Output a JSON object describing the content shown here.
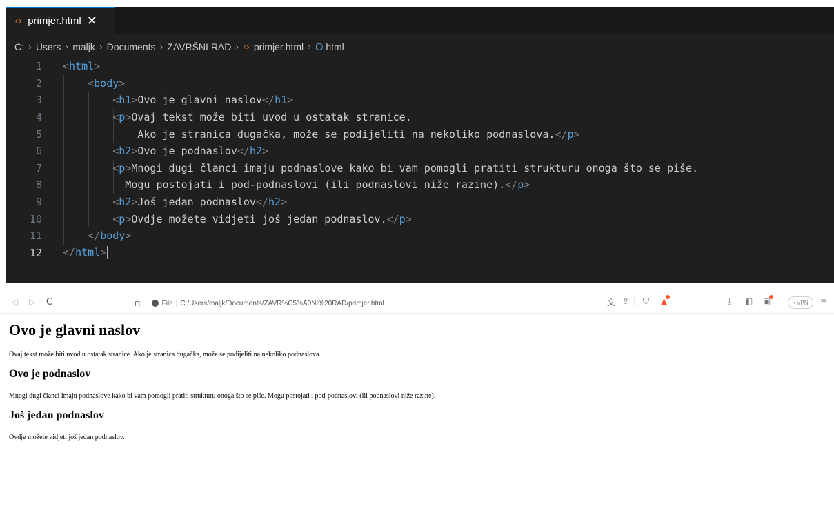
{
  "editor": {
    "tab": {
      "label": "primjer.html",
      "close": "✕"
    },
    "breadcrumb": {
      "items": [
        "C:",
        "Users",
        "maljk",
        "Documents",
        "ZAVRŠNI RAD",
        "primjer.html",
        "html"
      ]
    },
    "lines": [
      {
        "n": "1",
        "tokens": [
          [
            "br",
            "<"
          ],
          [
            "tag",
            "html"
          ],
          [
            "br",
            ">"
          ]
        ]
      },
      {
        "n": "2",
        "tokens": [
          [
            "txt",
            "    "
          ],
          [
            "br",
            "<"
          ],
          [
            "tag",
            "body"
          ],
          [
            "br",
            ">"
          ]
        ]
      },
      {
        "n": "3",
        "tokens": [
          [
            "txt",
            "        "
          ],
          [
            "br",
            "<"
          ],
          [
            "tag",
            "h1"
          ],
          [
            "br",
            ">"
          ],
          [
            "txt",
            "Ovo je glavni naslov"
          ],
          [
            "br",
            "</"
          ],
          [
            "tag",
            "h1"
          ],
          [
            "br",
            ">"
          ]
        ]
      },
      {
        "n": "4",
        "tokens": [
          [
            "txt",
            "        "
          ],
          [
            "br",
            "<"
          ],
          [
            "tag",
            "p"
          ],
          [
            "br",
            ">"
          ],
          [
            "txt",
            "Ovaj tekst može biti uvod u ostatak stranice."
          ]
        ]
      },
      {
        "n": "5",
        "tokens": [
          [
            "txt",
            "            Ako je stranica dugačka, može se podijeliti na nekoliko podnaslova."
          ],
          [
            "br",
            "</"
          ],
          [
            "tag",
            "p"
          ],
          [
            "br",
            ">"
          ]
        ]
      },
      {
        "n": "6",
        "tokens": [
          [
            "txt",
            "        "
          ],
          [
            "br",
            "<"
          ],
          [
            "tag",
            "h2"
          ],
          [
            "br",
            ">"
          ],
          [
            "txt",
            "Ovo je podnaslov"
          ],
          [
            "br",
            "</"
          ],
          [
            "tag",
            "h2"
          ],
          [
            "br",
            ">"
          ]
        ]
      },
      {
        "n": "7",
        "tokens": [
          [
            "txt",
            "        "
          ],
          [
            "br",
            "<"
          ],
          [
            "tag",
            "p"
          ],
          [
            "br",
            ">"
          ],
          [
            "txt",
            "Mnogi dugi članci imaju podnaslove kako bi vam pomogli pratiti strukturu onoga što se piše."
          ]
        ]
      },
      {
        "n": "8",
        "tokens": [
          [
            "txt",
            "          Mogu postojati i pod-podnaslovi (ili podnaslovi niže razine)."
          ],
          [
            "br",
            "</"
          ],
          [
            "tag",
            "p"
          ],
          [
            "br",
            ">"
          ]
        ]
      },
      {
        "n": "9",
        "tokens": [
          [
            "txt",
            "        "
          ],
          [
            "br",
            "<"
          ],
          [
            "tag",
            "h2"
          ],
          [
            "br",
            ">"
          ],
          [
            "txt",
            "Još jedan podnaslov"
          ],
          [
            "br",
            "</"
          ],
          [
            "tag",
            "h2"
          ],
          [
            "br",
            ">"
          ]
        ]
      },
      {
        "n": "10",
        "tokens": [
          [
            "txt",
            "        "
          ],
          [
            "br",
            "<"
          ],
          [
            "tag",
            "p"
          ],
          [
            "br",
            ">"
          ],
          [
            "txt",
            "Ovdje možete vidjeti još jedan podnaslov."
          ],
          [
            "br",
            "</"
          ],
          [
            "tag",
            "p"
          ],
          [
            "br",
            ">"
          ]
        ]
      },
      {
        "n": "11",
        "tokens": [
          [
            "txt",
            "    "
          ],
          [
            "br",
            "</"
          ],
          [
            "tag",
            "body"
          ],
          [
            "br",
            ">"
          ]
        ]
      },
      {
        "n": "12",
        "tokens": [
          [
            "br",
            "</"
          ],
          [
            "tag",
            "html"
          ],
          [
            "br",
            ">"
          ]
        ],
        "active": true
      }
    ]
  },
  "browser": {
    "nav": {
      "back": "◁",
      "forward": "▷",
      "reload": "C"
    },
    "address": {
      "scheme_label": "File",
      "separator": "|",
      "url": "C:/Users/maljk/Documents/ZAVR%C5%A0NI%20RAD/primjer.html"
    },
    "vpn_label": "• VPN"
  },
  "page": {
    "h1": "Ovo je glavni naslov",
    "p1": "Ovaj tekst može biti uvod u ostatak stranice. Ako je stranica dugačka, može se podijeliti na nekoliko podnaslova.",
    "h2_1": "Ovo je podnaslov",
    "p2": "Mnogi dugi članci imaju podnaslove kako bi vam pomogli pratiti strukturu onoga što se piše. Mogu postojati i pod-podnaslovi (ili podnaslovi niže razine).",
    "h2_2": "Još jedan podnaslov",
    "p3": "Ovdje možete vidjeti još jedan podnaslov."
  },
  "colors": {
    "editor_bg": "#1f1f1f",
    "tag": "#569cd6",
    "bracket": "#808080",
    "text": "#cccccc",
    "file_icon": "#e37933",
    "brave_accent": "#fb542b"
  }
}
